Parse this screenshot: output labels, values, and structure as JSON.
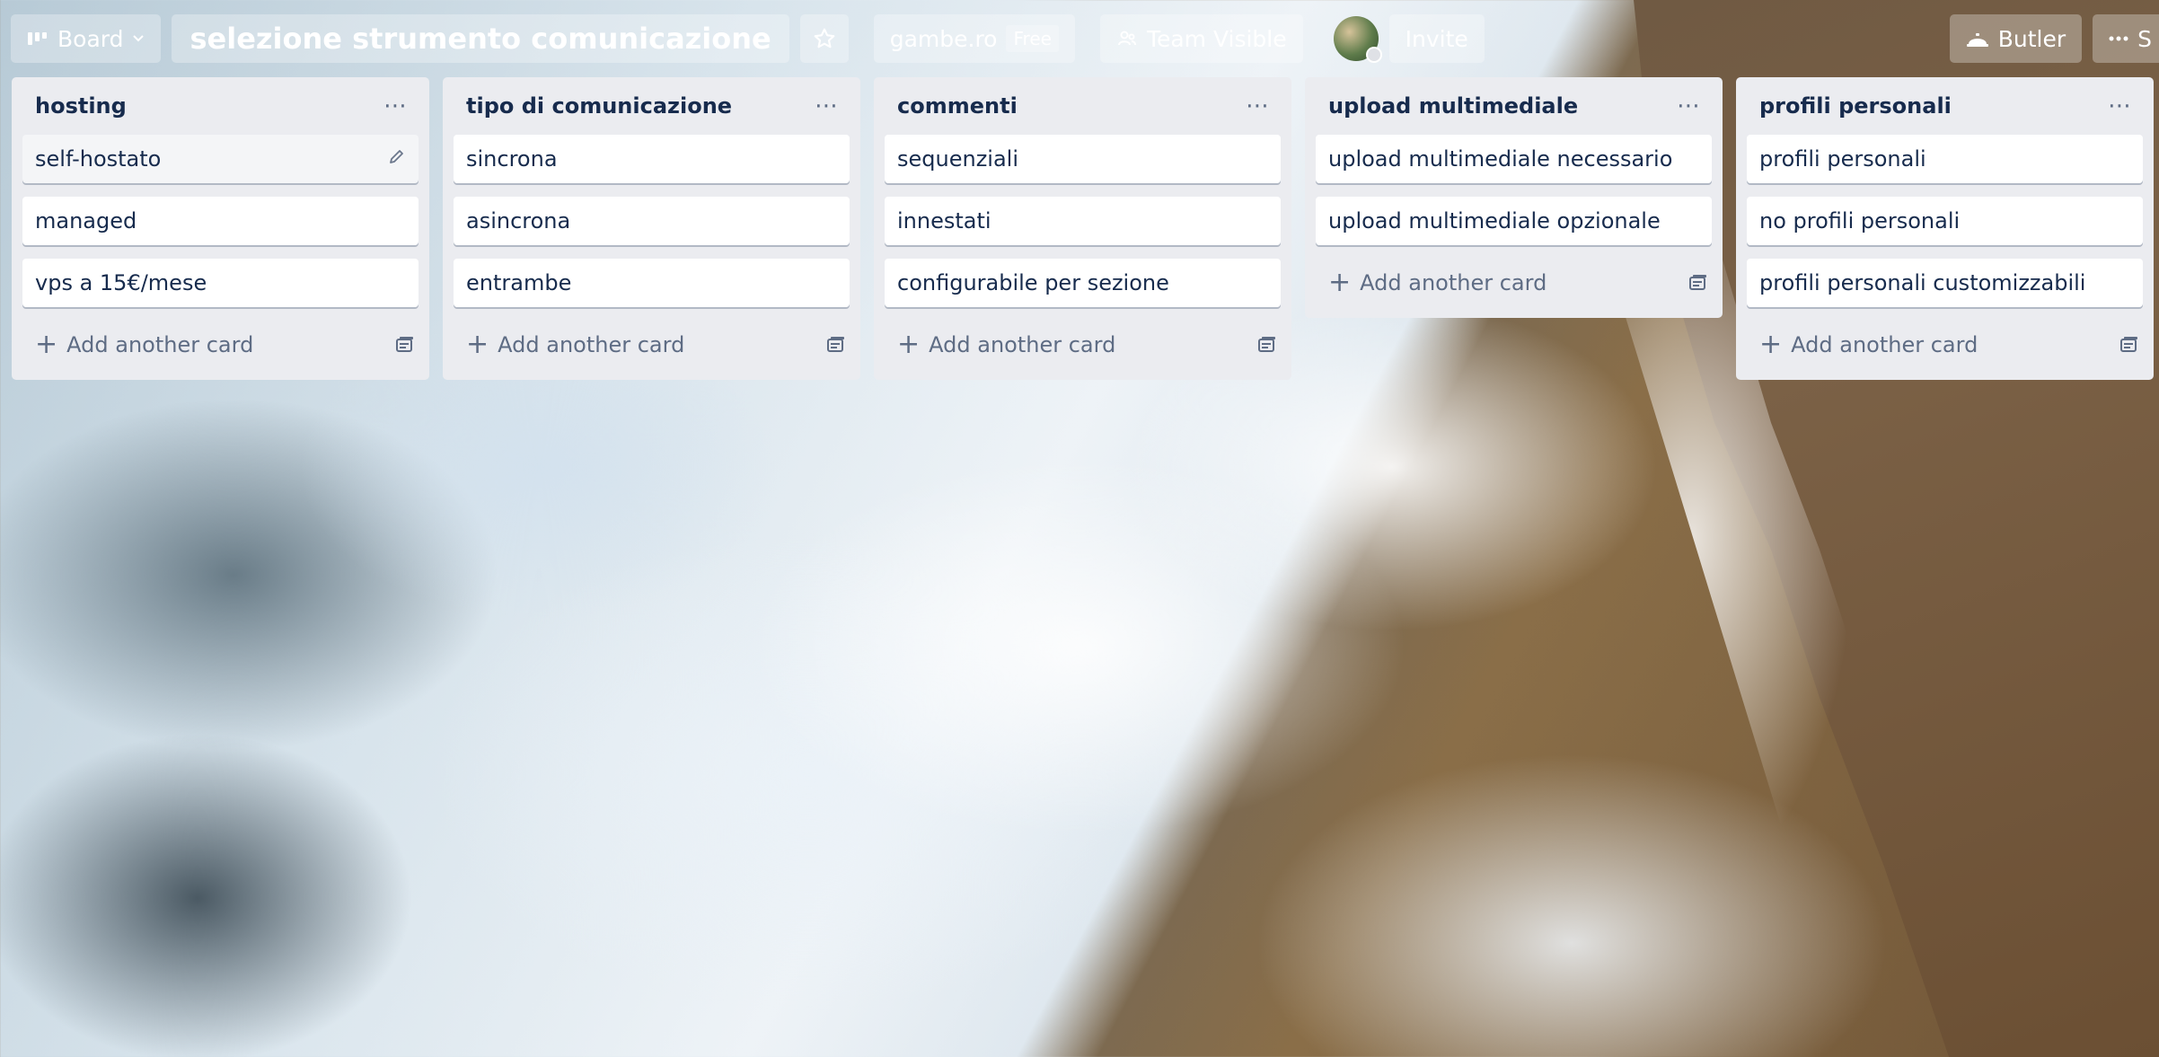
{
  "header": {
    "board_menu_label": "Board",
    "board_title": "selezione strumento comunicazione",
    "team_name": "gambe.ro",
    "plan_badge": "Free",
    "visibility_label": "Team Visible",
    "invite_label": "Invite",
    "butler_label": "Butler",
    "more_label": "S"
  },
  "icons": {
    "board": "board-icon",
    "chevron": "chevron-down-icon",
    "star": "star-icon",
    "visibility": "team-visibility-icon",
    "butler": "butler-bell-icon",
    "more": "more-icon"
  },
  "lists": [
    {
      "title": "hosting",
      "cards": [
        "self-hostato",
        "managed",
        "vps a 15€/mese"
      ],
      "add_card_label": "Add another card"
    },
    {
      "title": "tipo di comunicazione",
      "cards": [
        "sincrona",
        "asincrona",
        "entrambe"
      ],
      "add_card_label": "Add another card"
    },
    {
      "title": "commenti",
      "cards": [
        "sequenziali",
        "innestati",
        "configurabile per sezione"
      ],
      "add_card_label": "Add another card"
    },
    {
      "title": "upload multimediale",
      "cards": [
        "upload multimediale necessario",
        "upload multimediale opzionale"
      ],
      "add_card_label": "Add another card"
    },
    {
      "title": "profili personali",
      "cards": [
        "profili personali",
        "no profili personali",
        "profili personali customizzabili"
      ],
      "add_card_label": "Add another card"
    }
  ],
  "colors": {
    "list_bg": "#ebecf0",
    "card_bg": "#ffffff",
    "text": "#172b4d",
    "muted": "#5e6c84"
  }
}
